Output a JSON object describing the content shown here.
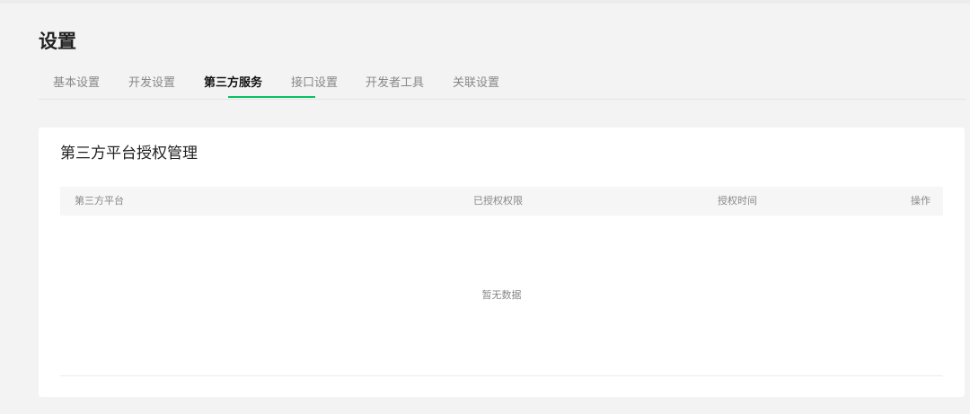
{
  "page": {
    "title": "设置"
  },
  "tabs": [
    {
      "label": "基本设置",
      "active": false
    },
    {
      "label": "开发设置",
      "active": false
    },
    {
      "label": "第三方服务",
      "active": true
    },
    {
      "label": "接口设置",
      "active": false
    },
    {
      "label": "开发者工具",
      "active": false
    },
    {
      "label": "关联设置",
      "active": false
    }
  ],
  "panel": {
    "title": "第三方平台授权管理",
    "columns": [
      "第三方平台",
      "已授权权限",
      "授权时间",
      "操作"
    ],
    "rows": [],
    "empty_text": "暂无数据"
  },
  "colors": {
    "accent": "#07c160",
    "background": "#f3f3f3",
    "card": "#ffffff",
    "table_header": "#f6f6f6"
  }
}
